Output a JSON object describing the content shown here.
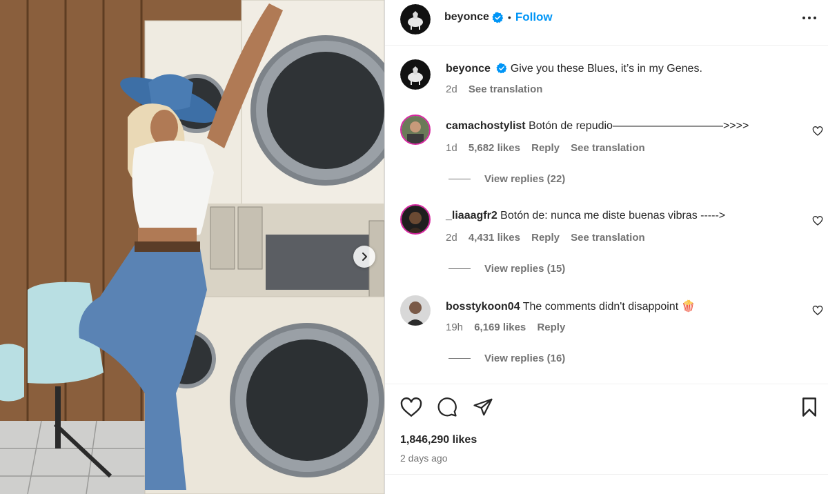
{
  "post": {
    "author": "beyonce",
    "follow_label": "Follow",
    "dot": "•",
    "caption": "Give you these Blues, it’s in my Genes.",
    "caption_time": "2d",
    "see_translation": "See translation",
    "likes": "1,846,290 likes",
    "posted": "2 days ago"
  },
  "comments": [
    {
      "user": "camachostylist",
      "text": "Botón de repudio——————————>>>>",
      "time": "1d",
      "likes": "5,682 likes",
      "reply": "Reply",
      "translate": "See translation",
      "replies": "View replies (22)"
    },
    {
      "user": "_liaaagfr2",
      "text": "Botón de: nunca me diste buenas vibras ----->",
      "time": "2d",
      "likes": "4,431 likes",
      "reply": "Reply",
      "translate": "See translation",
      "replies": "View replies (15)"
    },
    {
      "user": "bosstykoon04",
      "text": "The comments didn't disappoint 🍿",
      "time": "19h",
      "likes": "6,169 likes",
      "reply": "Reply",
      "replies": "View replies (16)"
    }
  ],
  "icons": {
    "verified": "verified-badge-icon",
    "more": "more-options-icon",
    "like": "heart-icon",
    "comment": "comment-icon",
    "share": "paper-plane-icon",
    "save": "bookmark-icon",
    "next": "chevron-right-icon"
  },
  "colors": {
    "accent": "#0095f6",
    "text": "#262626",
    "muted": "#737373",
    "story_ring": "#d6249f"
  }
}
